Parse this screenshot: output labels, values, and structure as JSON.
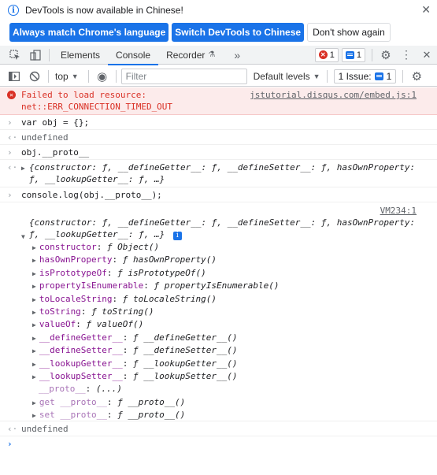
{
  "infobar": {
    "message": "DevTools is now available in Chinese!",
    "btn_match": "Always match Chrome's language",
    "btn_switch": "Switch DevTools to Chinese",
    "btn_dont_show": "Don't show again"
  },
  "tabs": {
    "elements": "Elements",
    "console": "Console",
    "recorder": "Recorder",
    "more": "»"
  },
  "badges": {
    "errors": "1",
    "messages": "1"
  },
  "toolbar": {
    "context": "top",
    "filter_placeholder": "Filter",
    "levels": "Default levels",
    "issues": "1 Issue:",
    "issues_count": "1"
  },
  "console": {
    "error": {
      "line1": "Failed to load resource:",
      "line2": "net::ERR_CONNECTION_TIMED_OUT",
      "source": "jstutorial.disqus.com/embed.js:1"
    },
    "input1": "var obj = {};",
    "result1": "undefined",
    "input2": "obj.__proto__",
    "proto_summary1": "{constructor: ƒ, __defineGetter__: ƒ, __defineSetter__: ƒ, hasOwnProperty:",
    "proto_summary2": "ƒ, __lookupGetter__: ƒ, …}",
    "input3": "console.log(obj.__proto__);",
    "log_source": "VM234:1",
    "log_summary1": "{constructor: ƒ, __defineGetter__: ƒ, __defineSetter__: ƒ, hasOwnProperty:",
    "log_summary2": "ƒ, __lookupGetter__: ƒ, …}",
    "properties": [
      {
        "key": "constructor",
        "val": "ƒ Object()"
      },
      {
        "key": "hasOwnProperty",
        "val": "ƒ hasOwnProperty()"
      },
      {
        "key": "isPrototypeOf",
        "val": "ƒ isPrototypeOf()"
      },
      {
        "key": "propertyIsEnumerable",
        "val": "ƒ propertyIsEnumerable()"
      },
      {
        "key": "toLocaleString",
        "val": "ƒ toLocaleString()"
      },
      {
        "key": "toString",
        "val": "ƒ toString()"
      },
      {
        "key": "valueOf",
        "val": "ƒ valueOf()"
      },
      {
        "key": "__defineGetter__",
        "val": "ƒ __defineGetter__()"
      },
      {
        "key": "__defineSetter__",
        "val": "ƒ __defineSetter__()"
      },
      {
        "key": "__lookupGetter__",
        "val": "ƒ __lookupGetter__()"
      },
      {
        "key": "__lookupSetter__",
        "val": "ƒ __lookupSetter__()"
      }
    ],
    "proto_key": "__proto__",
    "proto_val": "(...)",
    "getter": {
      "key": "get __proto__",
      "val": "ƒ __proto__()"
    },
    "setter": {
      "key": "set __proto__",
      "val": "ƒ __proto__()"
    },
    "result2": "undefined"
  },
  "colors": {
    "accent": "#1a73e8",
    "error": "#d93025",
    "error_bg": "#fcebeb",
    "purple": "#881391"
  }
}
